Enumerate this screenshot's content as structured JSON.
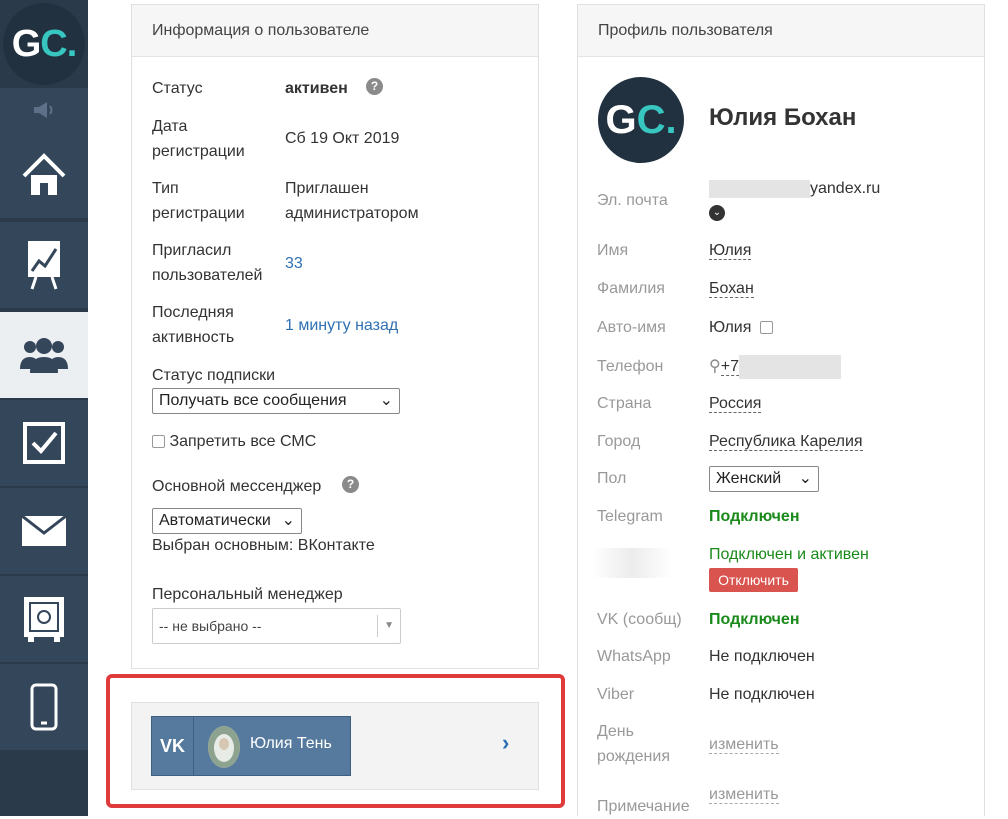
{
  "sidebar": {
    "logo_text_g": "G",
    "logo_text_c": "C.",
    "items": [
      {
        "icon": "home-icon"
      },
      {
        "icon": "chart-board-icon"
      },
      {
        "icon": "users-icon",
        "active": true
      },
      {
        "icon": "checkbox-icon"
      },
      {
        "icon": "mail-icon"
      },
      {
        "icon": "safe-icon"
      },
      {
        "icon": "phone-icon"
      }
    ]
  },
  "user_info": {
    "title": "Информация о пользователе",
    "status_label": "Статус",
    "status_value": "активен",
    "reg_date_label_1": "Дата",
    "reg_date_label_2": "регистрации",
    "reg_date_value": "Сб 19 Окт 2019",
    "reg_type_label_1": "Тип",
    "reg_type_label_2": "регистрации",
    "reg_type_value_1": "Приглашен",
    "reg_type_value_2": "администратором",
    "invited_label_1": "Пригласил",
    "invited_label_2": "пользователей",
    "invited_value": "33",
    "last_activity_label_1": "Последняя",
    "last_activity_label_2": "активность",
    "last_activity_value": "1 минуту назад",
    "subscription_label": "Статус подписки",
    "subscription_value": "Получать все сообщения",
    "ban_sms_label": "Запретить все СМС",
    "messenger_label": "Основной мессенджер",
    "messenger_value": "Автоматически",
    "messenger_chosen": "Выбран основным: ВКонтакте",
    "manager_label": "Персональный менеджер",
    "manager_value": "-- не выбрано --"
  },
  "vk_card": {
    "name": "Юлия Тень"
  },
  "profile": {
    "title": "Профиль пользователя",
    "name": "Юлия Бохан",
    "email_label": "Эл. почта",
    "email_value": "yandex.ru",
    "first_name_label": "Имя",
    "first_name_value": "Юлия",
    "last_name_label": "Фамилия",
    "last_name_value": "Бохан",
    "auto_name_label": "Авто-имя",
    "auto_name_value": "Юлия",
    "phone_label": "Телефон",
    "phone_value": "+7",
    "country_label": "Страна",
    "country_value": "Россия",
    "city_label": "Город",
    "city_value": "Республика Карелия",
    "gender_label": "Пол",
    "gender_value": "Женский",
    "telegram_label": "Telegram",
    "telegram_value": "Подключен",
    "hidden_value": "Подключен и активен",
    "disconnect_button": "Отключить",
    "vk_label": "VK (сообщ)",
    "vk_value": "Подключен",
    "whatsapp_label": "WhatsApp",
    "whatsapp_value": "Не подключен",
    "viber_label": "Viber",
    "viber_value": "Не подключен",
    "birthday_label_1": "День",
    "birthday_label_2": "рождения",
    "birthday_value": "изменить",
    "note_label": "Примечание",
    "note_value": "изменить"
  }
}
